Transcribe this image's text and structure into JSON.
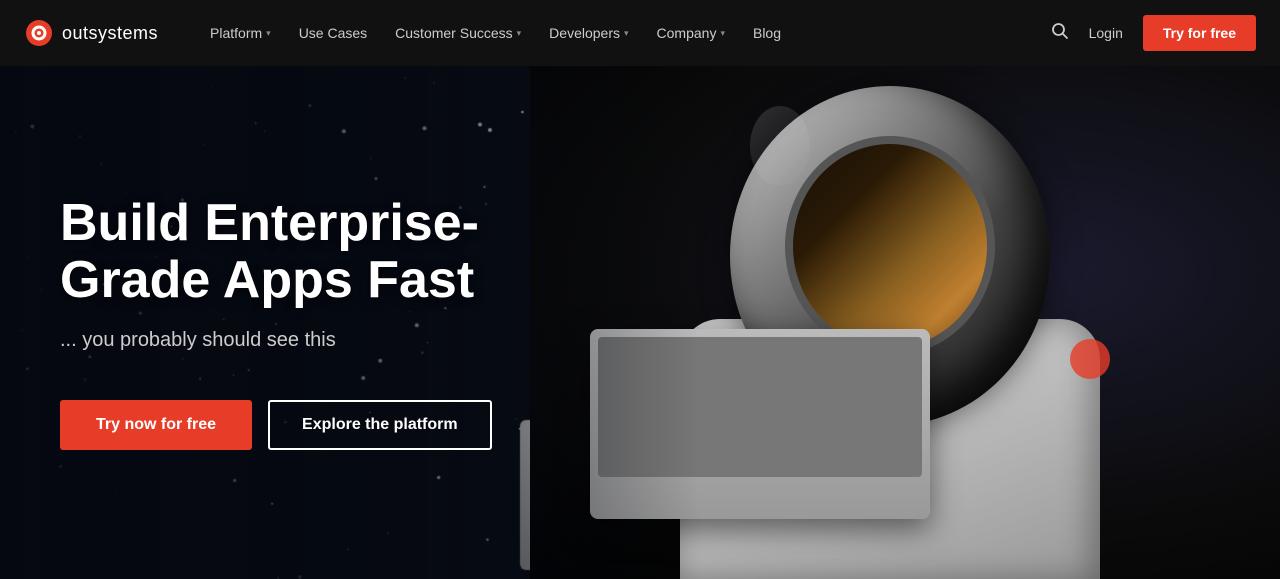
{
  "logo": {
    "text": "outsystems",
    "icon_name": "outsystems-logo-icon"
  },
  "navbar": {
    "items": [
      {
        "label": "Platform",
        "has_dropdown": true
      },
      {
        "label": "Use Cases",
        "has_dropdown": false
      },
      {
        "label": "Customer Success",
        "has_dropdown": true
      },
      {
        "label": "Developers",
        "has_dropdown": true
      },
      {
        "label": "Company",
        "has_dropdown": true
      },
      {
        "label": "Blog",
        "has_dropdown": false
      }
    ],
    "login_label": "Login",
    "try_free_label": "Try for free"
  },
  "hero": {
    "title": "Build Enterprise-Grade Apps Fast",
    "subtitle": "... you probably should see this",
    "cta_primary": "Try now for free",
    "cta_secondary": "Explore the platform"
  },
  "colors": {
    "accent_red": "#e63c28",
    "nav_bg": "#111111",
    "hero_bg": "#080c14"
  }
}
